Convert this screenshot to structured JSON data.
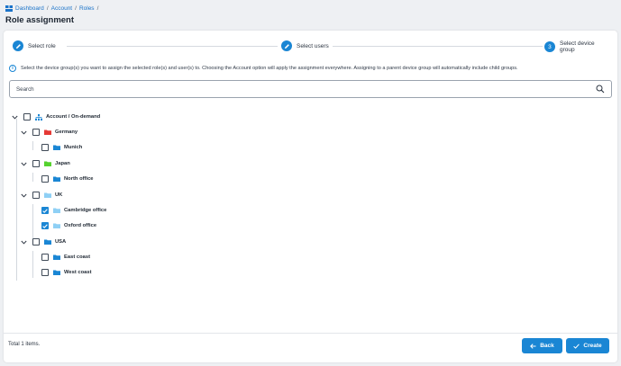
{
  "breadcrumb": {
    "items": [
      "Dashboard",
      "Account",
      "Roles"
    ],
    "separator": "/"
  },
  "page": {
    "title": "Role assignment"
  },
  "stepper": {
    "steps": [
      {
        "label": "Select role",
        "state": "done",
        "icon": "pencil-icon"
      },
      {
        "label": "Select users",
        "state": "done",
        "icon": "pencil-icon"
      },
      {
        "label": "Select device group",
        "state": "current",
        "number": "3"
      }
    ]
  },
  "info": {
    "icon": "info-icon",
    "text": "Select the device group(s) you want to assign the selected role(s) and user(s) to. Choosing the Account option will apply the assignment everywhere. Assigning to a parent device group will automatically include child groups."
  },
  "search": {
    "placeholder": "Search",
    "value": ""
  },
  "tree": {
    "root": {
      "label": "Account / On-demand",
      "checked": false,
      "expanded": true,
      "icon": "hierarchy-icon"
    },
    "groups": [
      {
        "label": "Germany",
        "color": "#e53935",
        "checked": false,
        "expanded": true,
        "children": [
          {
            "label": "Munich",
            "color": "#1a86d4",
            "checked": false
          }
        ]
      },
      {
        "label": "Japan",
        "color": "#55d22e",
        "checked": false,
        "expanded": true,
        "children": [
          {
            "label": "North office",
            "color": "#1a86d4",
            "checked": false
          }
        ]
      },
      {
        "label": "UK",
        "color": "#8fd0f5",
        "checked": false,
        "expanded": true,
        "children": [
          {
            "label": "Cambridge office",
            "color": "#8fd0f5",
            "checked": true
          },
          {
            "label": "Oxford office",
            "color": "#8fd0f5",
            "checked": true
          }
        ]
      },
      {
        "label": "USA",
        "color": "#1a86d4",
        "checked": false,
        "expanded": true,
        "children": [
          {
            "label": "East coast",
            "color": "#1a86d4",
            "checked": false
          },
          {
            "label": "West coast",
            "color": "#1a86d4",
            "checked": false
          }
        ]
      }
    ]
  },
  "footer": {
    "total_text": "Total 1 items.",
    "back_label": "Back",
    "create_label": "Create"
  },
  "colors": {
    "accent": "#1a86d4"
  }
}
